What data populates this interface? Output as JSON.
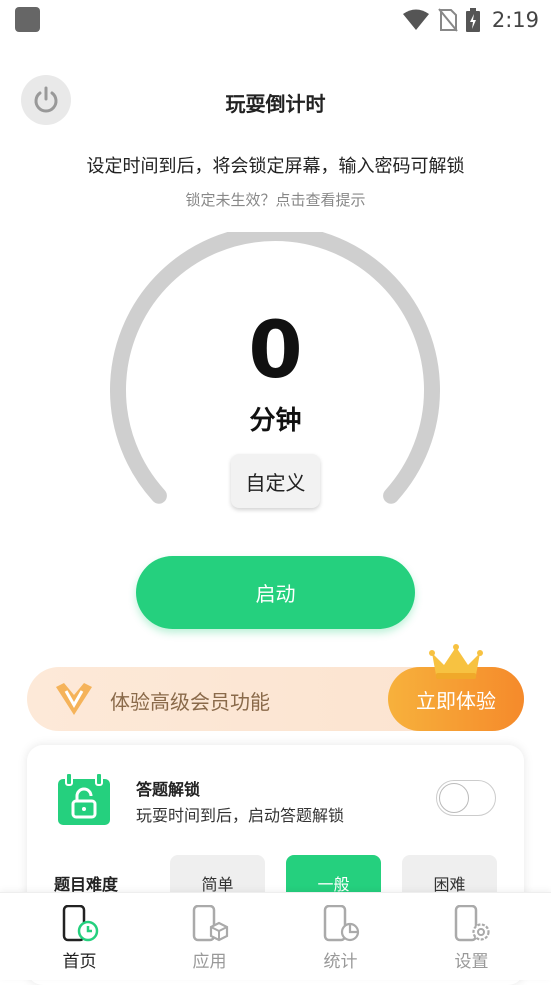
{
  "status": {
    "time": "2:19"
  },
  "header": {
    "title": "玩耍倒计时"
  },
  "main": {
    "description": "设定时间到后，将会锁定屏幕，输入密码可解锁",
    "hint": "锁定未生效？点击查看提示",
    "gauge_value": "0",
    "gauge_unit": "分钟",
    "custom_label": "自定义",
    "start_label": "启动"
  },
  "vip": {
    "text": "体验高级会员功能",
    "button": "立即体验"
  },
  "quiz": {
    "title": "答题解锁",
    "description": "玩耍时间到后，启动答题解锁",
    "enabled": false,
    "difficulty_label": "题目难度",
    "difficulties": [
      "简单",
      "一般",
      "困难"
    ],
    "selected_difficulty": "一般"
  },
  "nav": {
    "items": [
      {
        "label": "首页",
        "icon": "home-phone-timer-icon",
        "active": true
      },
      {
        "label": "应用",
        "icon": "apps-phone-box-icon",
        "active": false
      },
      {
        "label": "统计",
        "icon": "stats-phone-chart-icon",
        "active": false
      },
      {
        "label": "设置",
        "icon": "settings-phone-gear-icon",
        "active": false
      }
    ]
  },
  "colors": {
    "accent": "#25d07e",
    "vip_orange": "#f58a2b",
    "gauge_track": "#cfcfcf"
  }
}
